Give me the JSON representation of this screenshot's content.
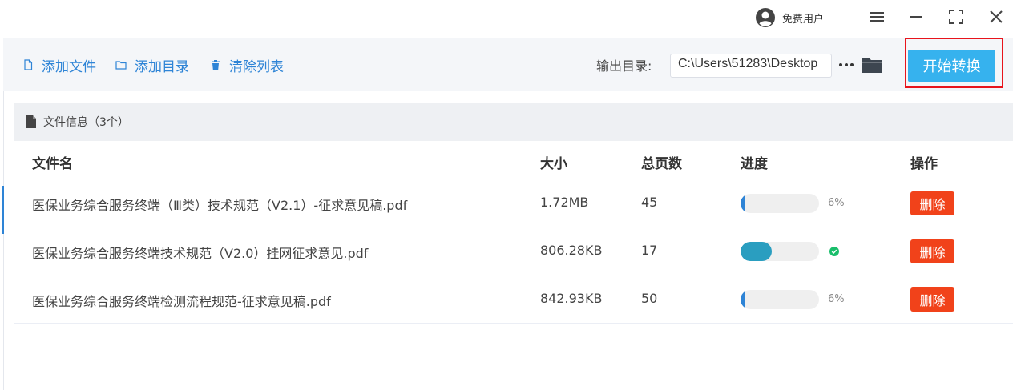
{
  "titlebar": {
    "user_name": "免费用户",
    "icons": [
      "user-avatar-icon",
      "menu-icon",
      "minimize-icon",
      "maximize-icon",
      "close-icon"
    ]
  },
  "toolbar": {
    "add_file": "添加文件",
    "add_folder": "添加目录",
    "clear_list": "清除列表",
    "output_label": "输出目录:",
    "output_path": "C:\\Users\\51283\\Desktop",
    "start_label": "开始转换"
  },
  "info": {
    "title": "文件信息（3个）"
  },
  "table": {
    "headers": {
      "name": "文件名",
      "size": "大小",
      "pages": "总页数",
      "progress": "进度",
      "action": "操作"
    },
    "rows": [
      {
        "name": "医保业务综合服务终端（Ⅲ类）技术规范（V2.1）-征求意见稿.pdf",
        "size": "1.72MB",
        "pages": "45",
        "progress": 0.06,
        "progress_text": "6%",
        "status": "in-progress",
        "action": "删除"
      },
      {
        "name": "医保业务综合服务终端技术规范（V2.0）挂网征求意见.pdf",
        "size": "806.28KB",
        "pages": "17",
        "progress": 0.4,
        "progress_text": "",
        "status": "done",
        "action": "删除"
      },
      {
        "name": "医保业务综合服务终端检测流程规范-征求意见稿.pdf",
        "size": "842.93KB",
        "pages": "50",
        "progress": 0.06,
        "progress_text": "6%",
        "status": "in-progress",
        "action": "删除"
      }
    ]
  },
  "colors": {
    "accent": "#2e84d6",
    "start_button": "#36b2ee",
    "delete_button": "#f1421a",
    "highlight_outline": "#e8141c",
    "progress_active": "#2e84d6",
    "progress_done": "#2a9ec0",
    "success": "#19be6b"
  }
}
